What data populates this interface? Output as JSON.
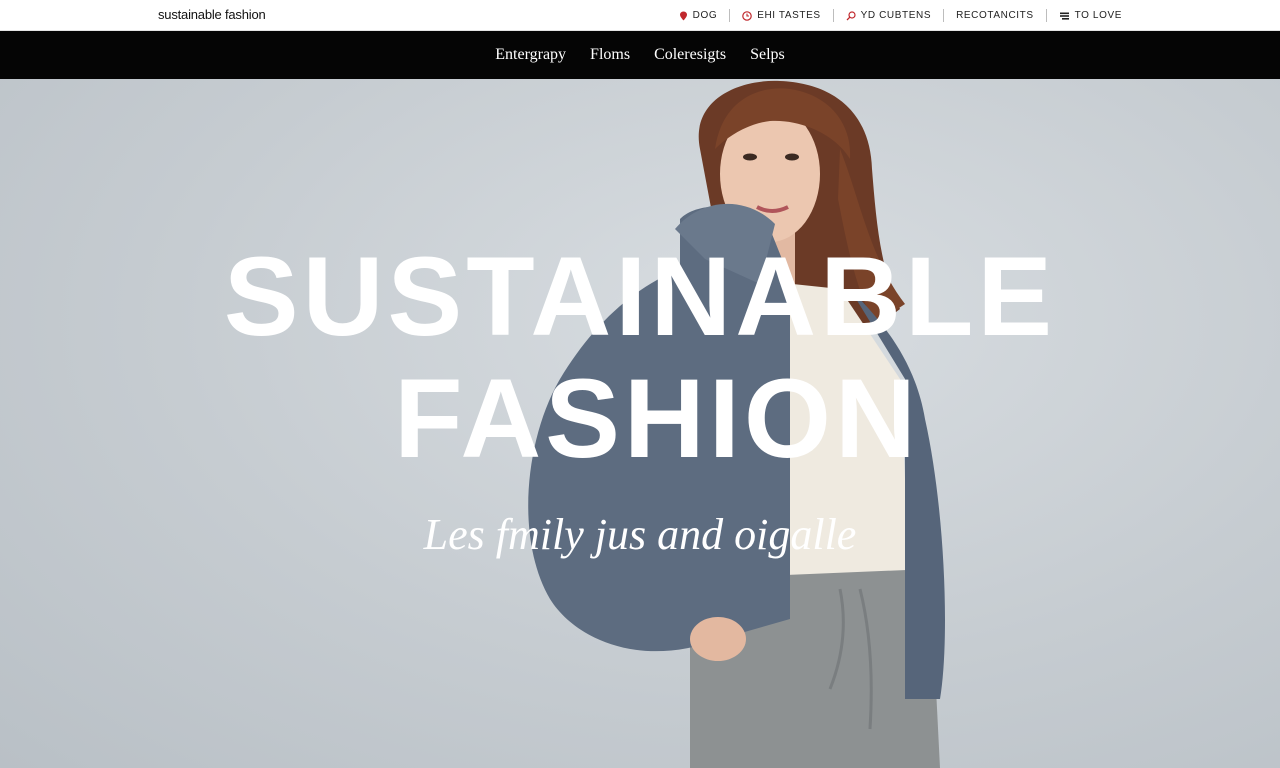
{
  "site": {
    "logo": "sustainable fashion"
  },
  "utility_links": [
    {
      "label": "DOG",
      "icon": "location-pin-icon"
    },
    {
      "label": "EHI TASTES",
      "icon": "clock-icon"
    },
    {
      "label": "YD CUBTENS",
      "icon": "search-icon"
    },
    {
      "label": "RECOTANCITS",
      "icon": ""
    },
    {
      "label": "TO LOVE",
      "icon": "bag-icon"
    }
  ],
  "nav": {
    "items": [
      "Entergrapy",
      "Floms",
      "Coleresigts",
      "Selps"
    ]
  },
  "hero": {
    "headline_line1": "SUSTAINABLE",
    "headline_line2": "FASHION",
    "tagline": "Les fmily jus and oigalle"
  },
  "colors": {
    "nav_background": "#050505",
    "hero_background": "#c9cfd4",
    "accent_red": "#c0282d",
    "headline": "#ffffff"
  }
}
